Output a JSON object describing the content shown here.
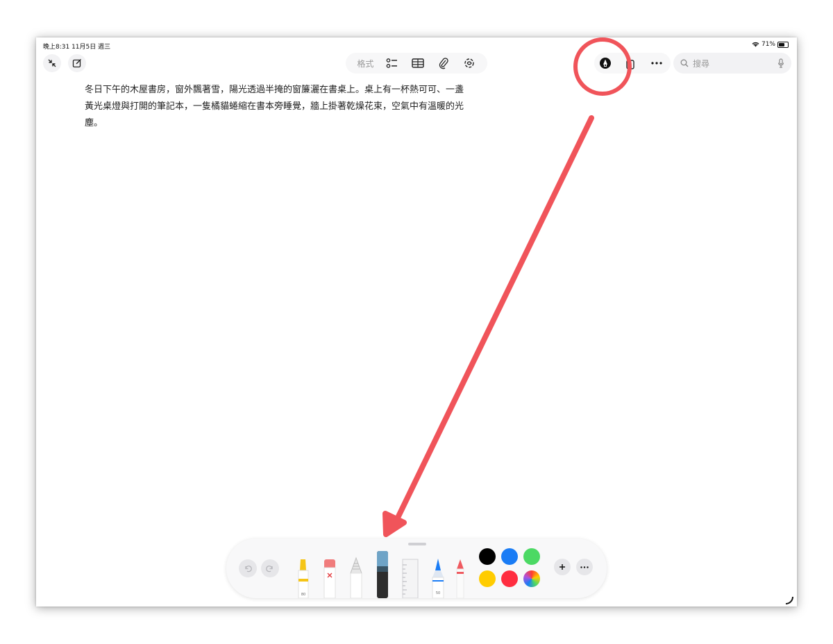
{
  "status_bar": {
    "time_date": "晚上8:31 11月5日 週三",
    "battery": "71%"
  },
  "toolbar": {
    "format_label": "格式"
  },
  "search": {
    "placeholder": "搜尋"
  },
  "note": {
    "body": "冬日下午的木屋書房，窗外飄著雪，陽光透過半掩的窗簾灑在書桌上。桌上有一杯熱可可、一盞黃光桌燈與打開的筆記本，一隻橘貓蜷縮在書本旁睡覺，牆上掛著乾燥花束，空氣中有溫暖的光塵。"
  },
  "palette": {
    "tools": [
      {
        "name": "highlighter",
        "width_label": "80"
      },
      {
        "name": "eraser"
      },
      {
        "name": "pencil"
      },
      {
        "name": "fountain-pen"
      },
      {
        "name": "ruler"
      },
      {
        "name": "pen",
        "width_label": "50"
      },
      {
        "name": "crayon"
      }
    ],
    "colors": [
      "#000000",
      "#1a7cf5",
      "#4cd964",
      "#ffcc00",
      "#ff2d40",
      "rainbow"
    ]
  },
  "annotation": {
    "color": "#f0545a"
  }
}
